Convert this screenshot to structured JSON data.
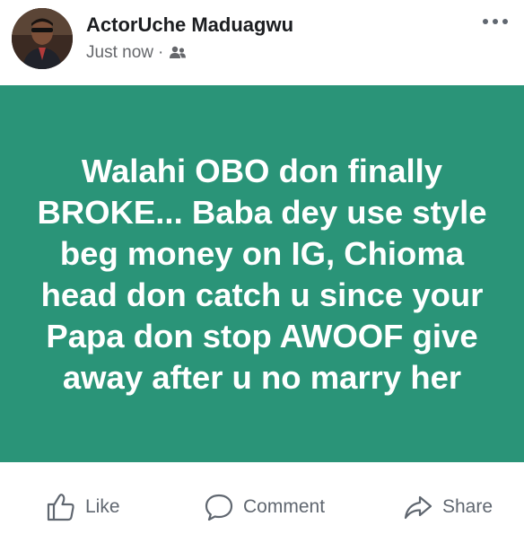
{
  "header": {
    "author": "ActorUche Maduagwu",
    "time": "Just now",
    "separator": "·",
    "audience_icon": "friends-icon",
    "more_icon": "more-options-icon"
  },
  "post": {
    "background_color": "#2a9478",
    "text": "Walahi OBO don finally BROKE... Baba dey use style beg money on IG, Chioma head don catch u since your Papa don stop AWOOF give away after u no marry her"
  },
  "actions": {
    "like_label": "Like",
    "comment_label": "Comment",
    "share_label": "Share"
  }
}
